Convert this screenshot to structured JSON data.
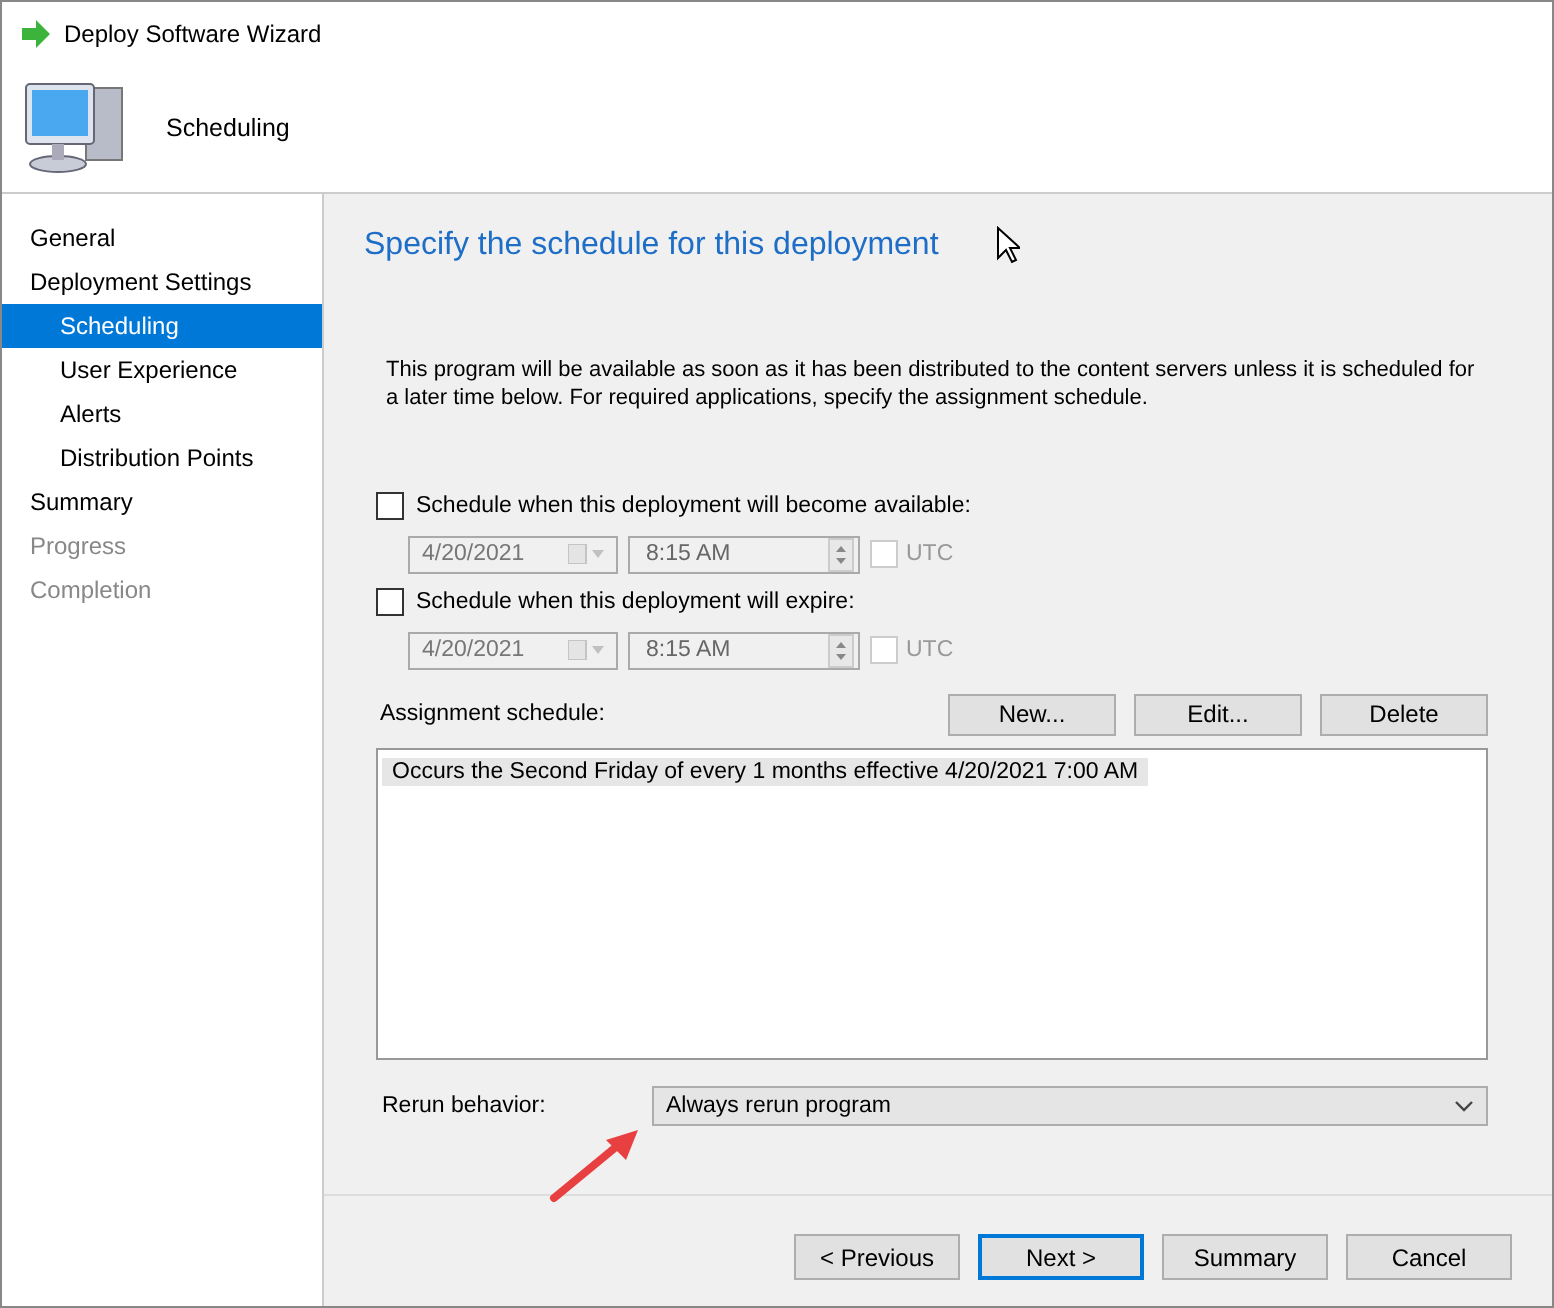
{
  "window": {
    "title": "Deploy Software Wizard"
  },
  "header": {
    "title": "Scheduling"
  },
  "steps": [
    {
      "label": "General",
      "selected": false,
      "disabled": false
    },
    {
      "label": "Deployment Settings",
      "selected": false,
      "disabled": false,
      "children": [
        {
          "label": "Scheduling",
          "selected": true,
          "disabled": false
        },
        {
          "label": "User Experience",
          "selected": false,
          "disabled": false
        },
        {
          "label": "Alerts",
          "selected": false,
          "disabled": false
        },
        {
          "label": "Distribution Points",
          "selected": false,
          "disabled": false
        }
      ]
    },
    {
      "label": "Summary",
      "selected": false,
      "disabled": false
    },
    {
      "label": "Progress",
      "selected": false,
      "disabled": true
    },
    {
      "label": "Completion",
      "selected": false,
      "disabled": true
    }
  ],
  "page": {
    "heading": "Specify the schedule for this deployment",
    "description": "This program will be available as soon as it has been distributed to the content servers unless it is scheduled for a later time below. For required applications, specify the assignment schedule.",
    "schedules": [
      {
        "label": "Schedule when this deployment will become available:",
        "checked": false,
        "date": "4/20/2021",
        "time": "8:15 AM",
        "utc_label": "UTC",
        "utc_checked": false
      },
      {
        "label": "Schedule when this deployment will expire:",
        "checked": false,
        "date": "4/20/2021",
        "time": "8:15 AM",
        "utc_label": "UTC",
        "utc_checked": false
      }
    ],
    "assignment": {
      "label": "Assignment schedule:",
      "buttons": [
        "New...",
        "Edit...",
        "Delete"
      ],
      "items": [
        {
          "text": "Occurs the Second Friday of every 1 months effective 4/20/2021 7:00 AM",
          "selected": true
        }
      ]
    },
    "rerun": {
      "label": "Rerun behavior:",
      "value": "Always rerun program"
    }
  },
  "buttons": [
    {
      "label": "< Previous",
      "default": false
    },
    {
      "label": "Next >",
      "default": true
    },
    {
      "label": "Summary",
      "default": false
    },
    {
      "label": "Cancel",
      "default": false
    }
  ]
}
